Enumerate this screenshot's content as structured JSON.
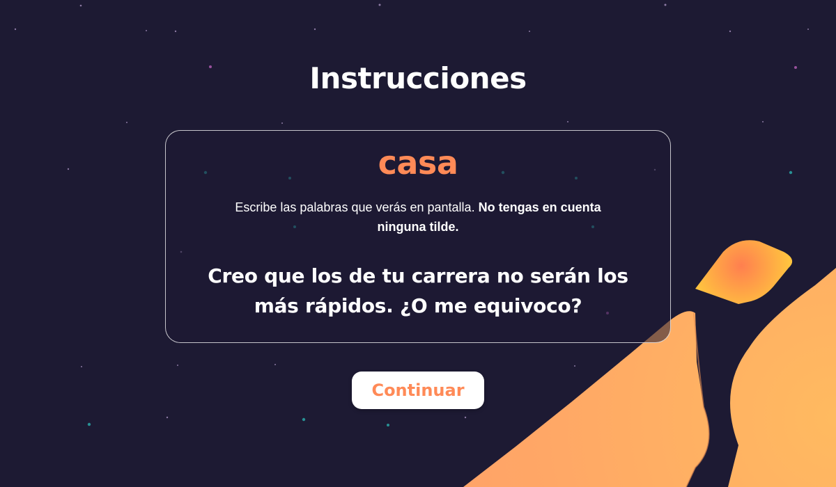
{
  "screen": {
    "title": "Instrucciones"
  },
  "card": {
    "word": "casa",
    "instruction_text": "Escribe las palabras que verás en pantalla. ",
    "instruction_emphasis": "No tengas en cuenta ninguna tilde.",
    "sentence": "Creo que los de tu carrera no serán los más rápidos. ¿O me equivoco?"
  },
  "actions": {
    "continue_label": "Continuar"
  },
  "colors": {
    "background": "#1d1a33",
    "accent": "#ff8a57",
    "text": "#ffffff",
    "mountain": "#ffab66",
    "rock": "#ffbe3d"
  }
}
